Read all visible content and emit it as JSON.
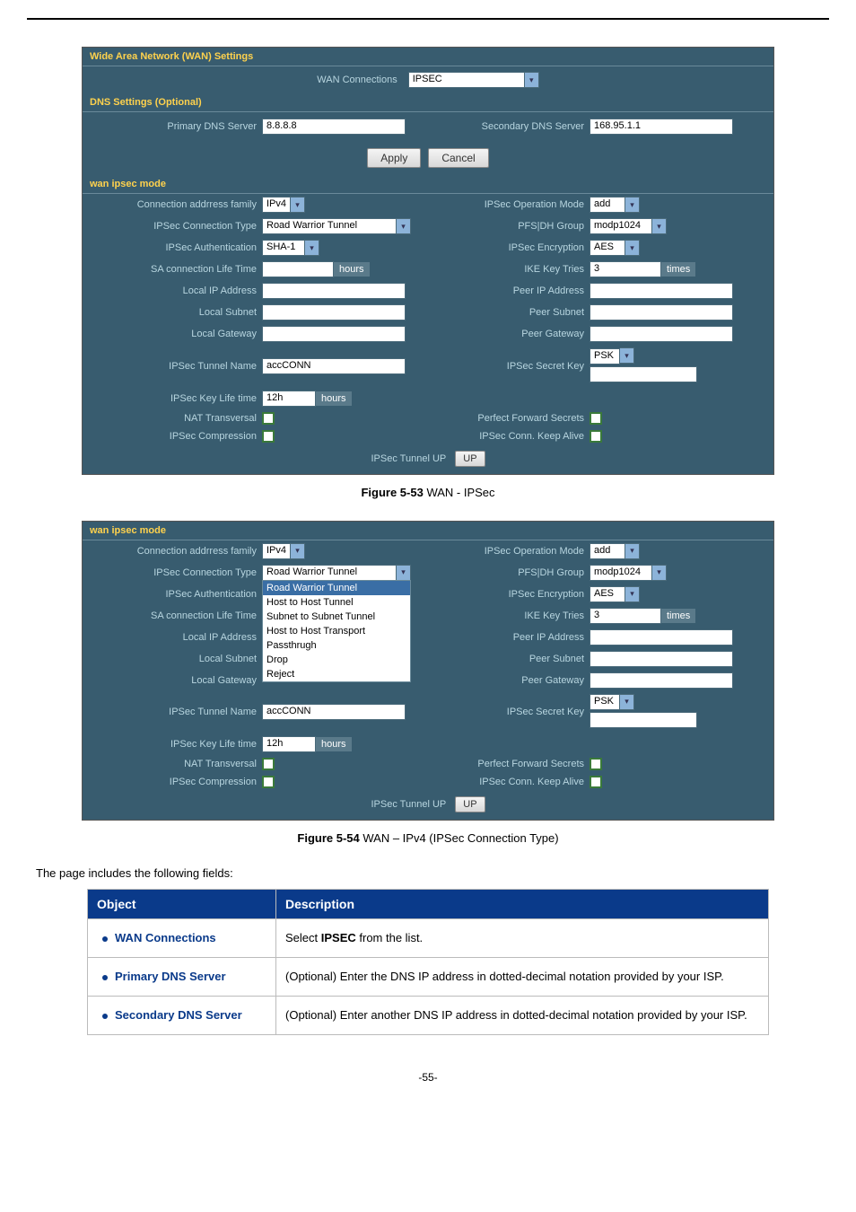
{
  "hr": true,
  "fig1": {
    "header_wan": "Wide Area Network (WAN) Settings",
    "wan_conn_label": "WAN Connections",
    "wan_conn_value": "IPSEC",
    "dns_header": "DNS Settings (Optional)",
    "primary_dns_label": "Primary DNS Server",
    "primary_dns_value": "8.8.8.8",
    "secondary_dns_label": "Secondary DNS Server",
    "secondary_dns_value": "168.95.1.1",
    "apply": "Apply",
    "cancel": "Cancel",
    "ipsec_header": "wan ipsec mode",
    "conn_family_label": "Connection addrress family",
    "conn_family_value": "IPv4",
    "op_mode_label": "IPSec Operation Mode",
    "op_mode_value": "add",
    "conn_type_label": "IPSec Connection Type",
    "conn_type_value": "Road Warrior Tunnel",
    "pfs_label": "PFS|DH Group",
    "pfs_value": "modp1024",
    "auth_label": "IPSec Authentication",
    "auth_value": "SHA-1",
    "enc_label": "IPSec Encryption",
    "enc_value": "AES",
    "sa_life_label": "SA connection Life Time",
    "sa_life_value": "",
    "hours_unit": "hours",
    "ike_tries_label": "IKE Key Tries",
    "ike_tries_value": "3",
    "times_unit": "times",
    "local_ip_label": "Local IP Address",
    "peer_ip_label": "Peer IP Address",
    "local_subnet_label": "Local Subnet",
    "peer_subnet_label": "Peer Subnet",
    "local_gw_label": "Local Gateway",
    "peer_gw_label": "Peer Gateway",
    "tunnel_name_label": "IPSec Tunnel Name",
    "tunnel_name_value": "accCONN",
    "secret_key_label": "IPSec Secret Key",
    "secret_key_type": "PSK",
    "key_life_label": "IPSec Key Life time",
    "key_life_value": "12h",
    "nat_label": "NAT Transversal",
    "pfs_secrets_label": "Perfect Forward Secrets",
    "compression_label": "IPSec Compression",
    "keepalive_label": "IPSec Conn. Keep Alive",
    "tunnel_up_label": "IPSec Tunnel UP",
    "up_btn": "UP"
  },
  "caption1_prefix": "Figure 5-53",
  "caption1_text": " WAN - IPSec",
  "fig2": {
    "ipsec_header": "wan ipsec mode",
    "dropdown_options": [
      "Road Warrior Tunnel",
      "Host to Host Tunnel",
      "Subnet to Subnet Tunnel",
      "Host to Host Transport",
      "Passthrugh",
      "Drop",
      "Reject"
    ]
  },
  "caption2_prefix": "Figure 5-54",
  "caption2_text": " WAN – IPv4 (IPSec Connection Type)",
  "intro": "The page includes the following fields:",
  "table": {
    "h1": "Object",
    "h2": "Description",
    "rows": [
      {
        "obj": "WAN Connections",
        "desc_pre": "Select ",
        "desc_bold": "IPSEC",
        "desc_post": " from the list."
      },
      {
        "obj": "Primary DNS Server",
        "desc": "(Optional) Enter the DNS IP address in dotted-decimal notation provided by your ISP."
      },
      {
        "obj": "Secondary DNS Server",
        "desc": "(Optional) Enter another DNS IP address in dotted-decimal notation provided by your ISP."
      }
    ]
  },
  "footer": "-55-"
}
